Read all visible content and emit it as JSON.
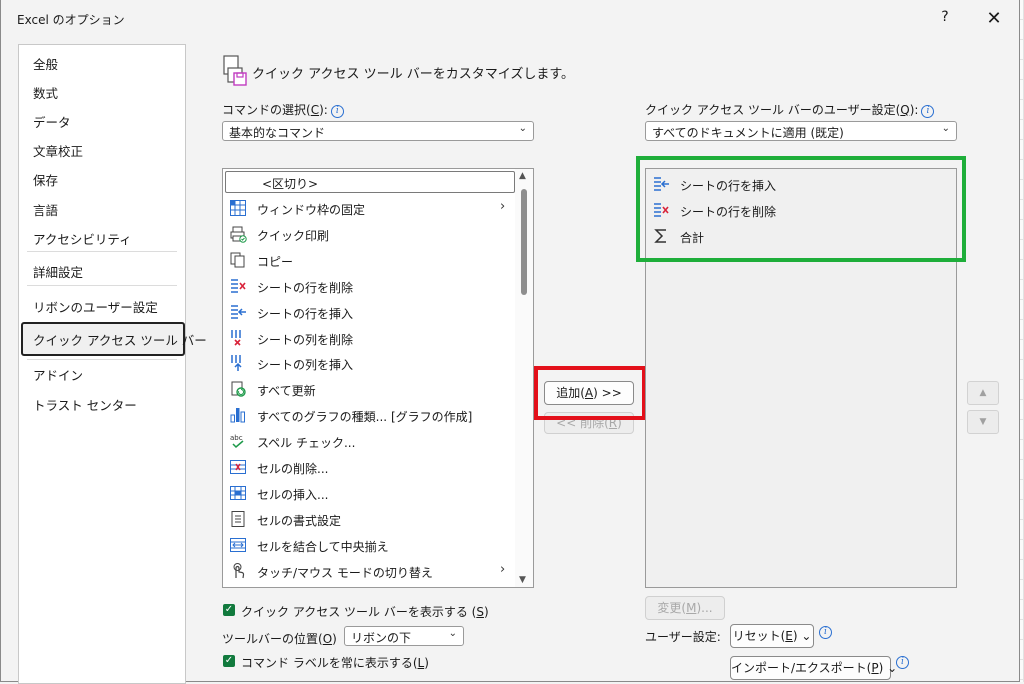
{
  "window": {
    "title": "Excel のオプション",
    "help": "?",
    "close": "✕"
  },
  "sidebar": {
    "items": [
      {
        "label": "全般"
      },
      {
        "label": "数式"
      },
      {
        "label": "データ"
      },
      {
        "label": "文章校正"
      },
      {
        "label": "保存"
      },
      {
        "label": "言語"
      },
      {
        "label": "アクセシビリティ"
      },
      {
        "label": "詳細設定"
      },
      {
        "label": "リボンのユーザー設定"
      },
      {
        "label": "クイック アクセス ツール バー",
        "selected": true
      },
      {
        "label": "アドイン"
      },
      {
        "label": "トラスト センター"
      }
    ]
  },
  "header": {
    "text": "クイック アクセス ツール バーをカスタマイズします。"
  },
  "left": {
    "label_pre": "コマンドの選択(",
    "label_key": "C",
    "label_post": "):",
    "select_value": "基本的なコマンド",
    "separator": "<区切り>",
    "commands": [
      {
        "label": "ウィンドウ枠の固定",
        "icon": "freeze-panes-icon",
        "submenu": true
      },
      {
        "label": "クイック印刷",
        "icon": "quick-print-icon"
      },
      {
        "label": "コピー",
        "icon": "copy-icon"
      },
      {
        "label": "シートの行を削除",
        "icon": "delete-row-icon"
      },
      {
        "label": "シートの行を挿入",
        "icon": "insert-row-icon"
      },
      {
        "label": "シートの列を削除",
        "icon": "delete-column-icon"
      },
      {
        "label": "シートの列を挿入",
        "icon": "insert-column-icon"
      },
      {
        "label": "すべて更新",
        "icon": "refresh-all-icon"
      },
      {
        "label": "すべてのグラフの種類... [グラフの作成]",
        "icon": "chart-icon"
      },
      {
        "label": "スペル チェック...",
        "icon": "spell-check-icon"
      },
      {
        "label": "セルの削除...",
        "icon": "delete-cells-icon"
      },
      {
        "label": "セルの挿入...",
        "icon": "insert-cells-icon"
      },
      {
        "label": "セルの書式設定",
        "icon": "format-cells-icon"
      },
      {
        "label": "セルを結合して中央揃え",
        "icon": "merge-center-icon"
      },
      {
        "label": "タッチ/マウス モードの切り替え",
        "icon": "touch-mode-icon",
        "submenu": true
      }
    ]
  },
  "right": {
    "label_pre": "クイック アクセス ツール バーのユーザー設定(",
    "label_key": "Q",
    "label_post": "):",
    "select_value": "すべてのドキュメントに適用 (既定)",
    "items": [
      {
        "label": "シートの行を挿入",
        "icon": "insert-row-icon"
      },
      {
        "label": "シートの行を削除",
        "icon": "delete-row-icon"
      },
      {
        "label": "合計",
        "icon": "sum-icon"
      }
    ]
  },
  "buttons": {
    "add_pre": "追加(",
    "add_key": "A",
    "add_post": ") >>",
    "remove_pre": "<< 削除(",
    "remove_key": "R",
    "remove_post": ")",
    "modify_pre": "変更(",
    "modify_key": "M",
    "modify_post": ")...",
    "reset_pre": "リセット(",
    "reset_key": "E",
    "reset_post": ") ⌄",
    "import_pre": "インポート/エクスポート(",
    "import_key": "P",
    "import_post": ") ⌄"
  },
  "bottom": {
    "show_qat_pre": "クイック アクセス ツール バーを表示する (",
    "show_qat_key": "S",
    "show_qat_post": ")",
    "position_pre": "ツールバーの位置(",
    "position_key": "O",
    "position_post": ")",
    "position_value": "リボンの下",
    "always_labels_pre": "コマンド ラベルを常に表示する(",
    "always_labels_key": "L",
    "always_labels_post": ")",
    "user_settings": "ユーザー設定:"
  },
  "colors": {
    "highlight_green": "#1eae3a",
    "highlight_red": "#e3101a",
    "checkbox": "#117a3d"
  }
}
